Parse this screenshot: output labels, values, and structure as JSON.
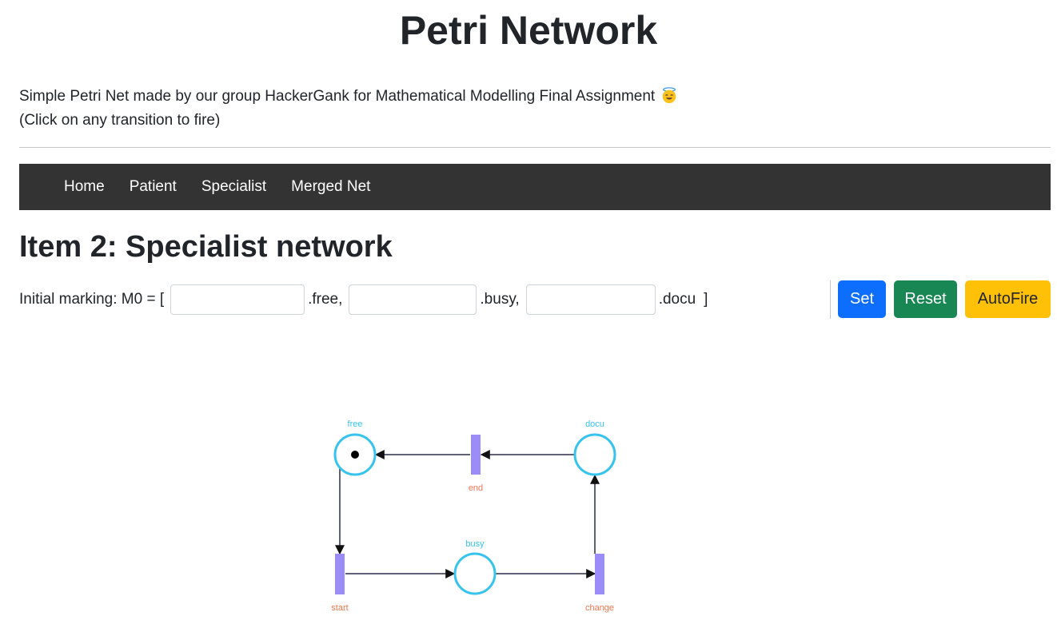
{
  "header": {
    "title": "Petri Network",
    "description": "Simple Petri Net made by our group HackerGank for Mathematical Modelling Final Assignment",
    "emoji_icon": "smiling-face-with-halo-icon",
    "hint": "(Click on any transition to fire)"
  },
  "nav": {
    "items": [
      {
        "label": "Home"
      },
      {
        "label": "Patient"
      },
      {
        "label": "Specialist"
      },
      {
        "label": "Merged Net"
      }
    ]
  },
  "main": {
    "heading": "Item 2: Specialist network",
    "marking": {
      "prefix": "Initial marking: M0 = [",
      "fields": [
        {
          "suffix": ".free,",
          "value": ""
        },
        {
          "suffix": ".busy,",
          "value": ""
        },
        {
          "suffix": ".docu",
          "value": ""
        }
      ],
      "close": "]"
    },
    "buttons": {
      "set": "Set",
      "reset": "Reset",
      "autofire": "AutoFire"
    }
  },
  "petri_net": {
    "places": [
      {
        "name": "free",
        "tokens": 1
      },
      {
        "name": "busy",
        "tokens": 0
      },
      {
        "name": "docu",
        "tokens": 0
      }
    ],
    "transitions": [
      {
        "name": "end"
      },
      {
        "name": "start"
      },
      {
        "name": "change"
      }
    ],
    "colors": {
      "place": "#36c3ee",
      "transition": "#9b8df8",
      "transition_label": "#f0754f",
      "arc": "#2b2f45",
      "navbar": "#333333",
      "set": "#0d6efd",
      "reset": "#198754",
      "autofire": "#ffc107"
    }
  }
}
